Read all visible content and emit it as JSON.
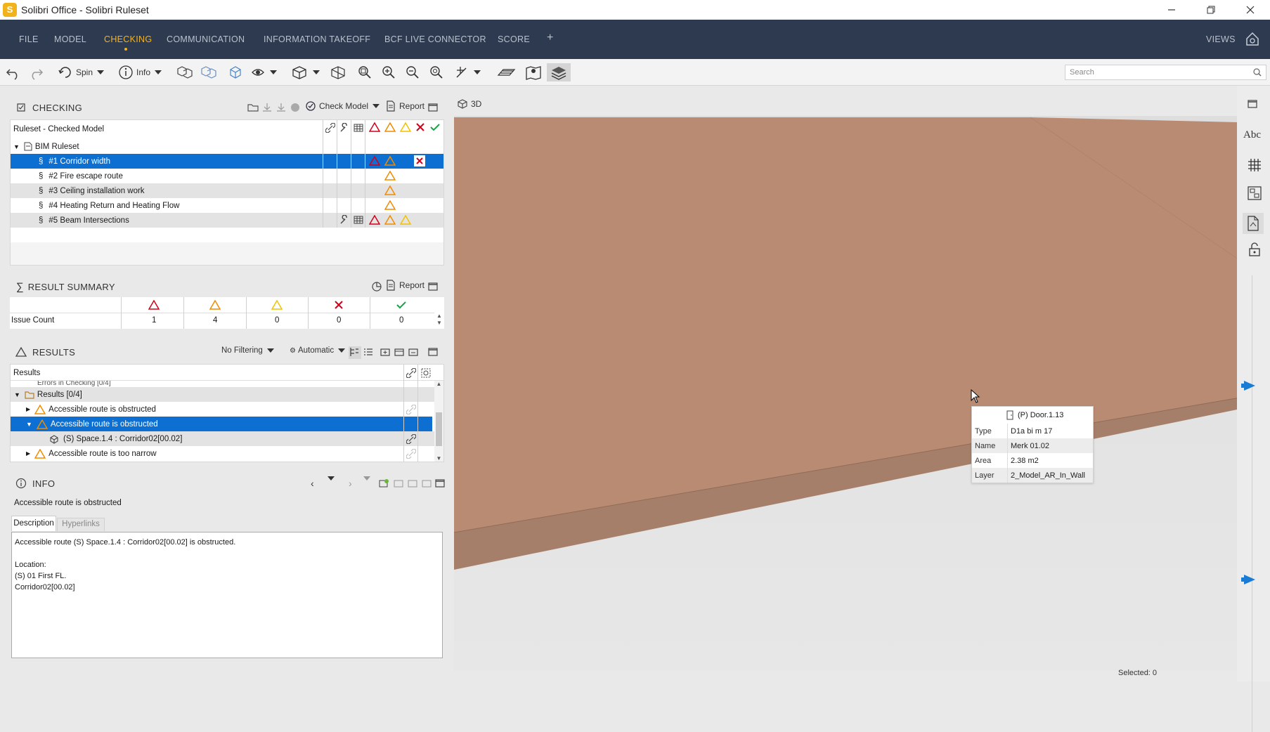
{
  "window": {
    "title": "Solibri Office - Solibri Ruleset",
    "logo_letter": "S"
  },
  "menu": {
    "items": [
      "FILE",
      "MODEL",
      "CHECKING",
      "COMMUNICATION",
      "INFORMATION TAKEOFF",
      "BCF LIVE CONNECTOR",
      "SCORE"
    ],
    "active": "CHECKING",
    "add_label": "+",
    "views_label": "VIEWS"
  },
  "toolbar": {
    "spin_label": "Spin",
    "info_label": "Info",
    "search_placeholder": "Search"
  },
  "checking": {
    "title": "CHECKING",
    "check_model_label": "Check Model",
    "report_label": "Report",
    "tree_header": "Ruleset - Checked Model",
    "root_label": "BIM Ruleset",
    "rules": [
      {
        "label": "#1 Corridor width",
        "selected": true
      },
      {
        "label": "#2 Fire escape route"
      },
      {
        "label": "#3 Ceiling installation work"
      },
      {
        "label": "#4 Heating Return and Heating Flow"
      },
      {
        "label": "#5 Beam Intersections"
      }
    ]
  },
  "result_summary": {
    "title": "RESULT SUMMARY",
    "report_label": "Report",
    "row_label": "Issue Count",
    "counts": [
      "1",
      "4",
      "0",
      "0",
      "0"
    ]
  },
  "results": {
    "title": "RESULTS",
    "filter_label": "No Filtering",
    "mode_label": "Automatic",
    "column_header": "Results",
    "partial_row": "Errors in Checking [0/4]",
    "group_label": "Results [0/4]",
    "items": [
      {
        "label": "Accessible route is obstructed",
        "selected": false
      },
      {
        "label": "Accessible route is obstructed",
        "selected": true
      },
      {
        "label": "(S) Space.1.4 : Corridor02[00.02]",
        "child": true
      },
      {
        "label": "Accessible route is too narrow",
        "selected": false
      }
    ]
  },
  "info": {
    "title": "INFO",
    "heading": "Accessible route is obstructed",
    "tabs": [
      "Description",
      "Hyperlinks"
    ],
    "description_lines": [
      "Accessible route (S) Space.1.4 : Corridor02[00.02] is obstructed.",
      "",
      "Location:",
      "(S) 01 First FL.",
      "Corridor02[00.02]"
    ]
  },
  "viewport": {
    "tab_label": "3D",
    "selected_label": "Selected: 0",
    "wall_color": "#b58a71",
    "door_color": "#e50000",
    "space_color": "#c13bb8"
  },
  "tooltip": {
    "title": "(P) Door.1.13",
    "rows": [
      {
        "key": "Type",
        "value": "D1a bi m 17"
      },
      {
        "key": "Name",
        "value": "Merk 01.02"
      },
      {
        "key": "Area",
        "value": "2.38 m2"
      },
      {
        "key": "Layer",
        "value": "2_Model_AR_In_Wall"
      }
    ]
  },
  "rightbar": {
    "text_tool_label": "Abc"
  },
  "colors": {
    "accent": "#f3b41b",
    "menu_bg": "#2e3a4f",
    "selection": "#0d6fd1"
  }
}
